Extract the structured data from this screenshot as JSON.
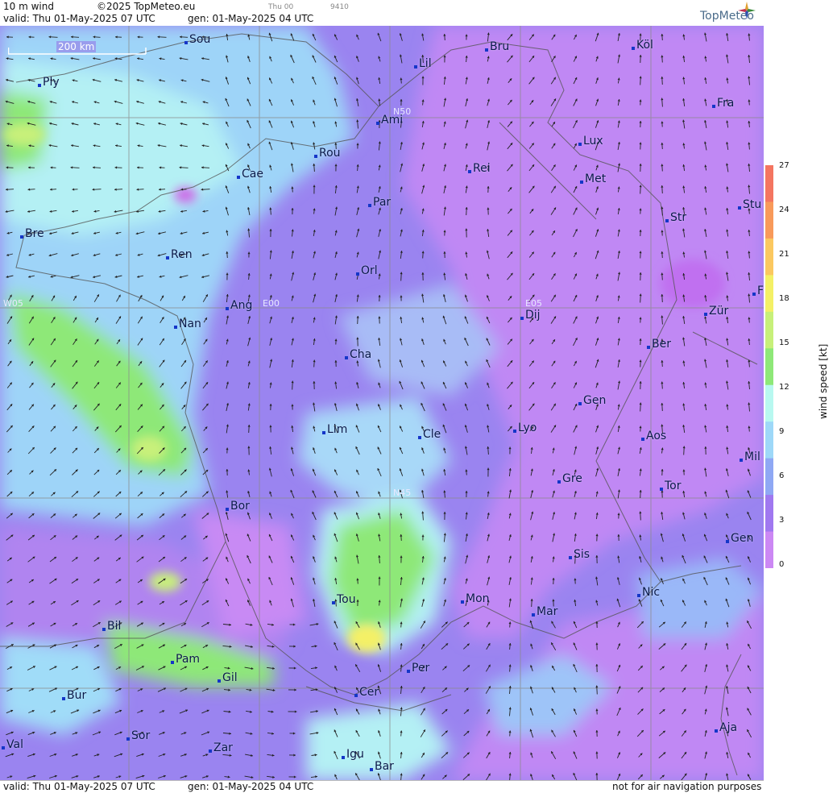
{
  "header": {
    "product": "10 m wind",
    "copyright": "©2025 TopMeteo.eu",
    "valid": "valid:  Thu  01-May-2025  07 UTC",
    "gen": "gen: 01-May-2025 04 UTC",
    "small_day": "Thu 00",
    "small_code": "9410",
    "logo": "TopMeteo"
  },
  "scale_bar": {
    "label": "200 km"
  },
  "footer": {
    "valid": "valid:  Thu  01-May-2025  07 UTC",
    "gen": "gen: 01-May-2025 04 UTC",
    "disclaimer": "not for air navigation purposes"
  },
  "colorbar": {
    "title": "wind speed [kt]",
    "ticks": [
      "27",
      "24",
      "21",
      "18",
      "15",
      "12",
      "9",
      "6",
      "3",
      "0"
    ],
    "colors": [
      "#f47560",
      "#f89a5a",
      "#fbc860",
      "#f4f066",
      "#c7f07a",
      "#8ee878",
      "#b8f8f0",
      "#9ed8f8",
      "#8fa8f4",
      "#a078f0",
      "#cc88f4"
    ]
  },
  "grid_labels": [
    {
      "id": "n50",
      "text": "N50"
    },
    {
      "id": "n45",
      "text": "N45"
    },
    {
      "id": "w05",
      "text": "W05"
    },
    {
      "id": "e00",
      "text": "E00"
    },
    {
      "id": "e05",
      "text": "E05"
    }
  ],
  "cities": [
    {
      "id": "sou",
      "name": "Sou"
    },
    {
      "id": "ply",
      "name": "Ply"
    },
    {
      "id": "lil",
      "name": "Lil"
    },
    {
      "id": "bru",
      "name": "Bru"
    },
    {
      "id": "kol",
      "name": "Köl"
    },
    {
      "id": "fra",
      "name": "Fra"
    },
    {
      "id": "ami",
      "name": "Ami"
    },
    {
      "id": "rou",
      "name": "Rou"
    },
    {
      "id": "lux",
      "name": "Lux"
    },
    {
      "id": "cae",
      "name": "Cae"
    },
    {
      "id": "rei",
      "name": "Rei"
    },
    {
      "id": "met",
      "name": "Met"
    },
    {
      "id": "par",
      "name": "Par"
    },
    {
      "id": "str",
      "name": "Str"
    },
    {
      "id": "stu",
      "name": "Stu"
    },
    {
      "id": "bre",
      "name": "Bre"
    },
    {
      "id": "ren",
      "name": "Ren"
    },
    {
      "id": "orl",
      "name": "Orl"
    },
    {
      "id": "ang",
      "name": "Ang"
    },
    {
      "id": "dij",
      "name": "Dij"
    },
    {
      "id": "zur",
      "name": "Zür"
    },
    {
      "id": "nan",
      "name": "Nan"
    },
    {
      "id": "ber",
      "name": "Ber"
    },
    {
      "id": "cha",
      "name": "Cha"
    },
    {
      "id": "gen1",
      "name": "Gen"
    },
    {
      "id": "lim",
      "name": "Lim"
    },
    {
      "id": "cle",
      "name": "Cle"
    },
    {
      "id": "lyo",
      "name": "Lyo"
    },
    {
      "id": "aos",
      "name": "Aos"
    },
    {
      "id": "mil",
      "name": "Mil"
    },
    {
      "id": "gre",
      "name": "Gre"
    },
    {
      "id": "tor",
      "name": "Tor"
    },
    {
      "id": "bor",
      "name": "Bor"
    },
    {
      "id": "gen2",
      "name": "Gen"
    },
    {
      "id": "sis",
      "name": "Sis"
    },
    {
      "id": "nic",
      "name": "Nic"
    },
    {
      "id": "tou",
      "name": "Tou"
    },
    {
      "id": "mon",
      "name": "Mon"
    },
    {
      "id": "mar",
      "name": "Mar"
    },
    {
      "id": "bil",
      "name": "Bil"
    },
    {
      "id": "pam",
      "name": "Pam"
    },
    {
      "id": "per",
      "name": "Per"
    },
    {
      "id": "gil",
      "name": "Gil"
    },
    {
      "id": "cer",
      "name": "Cer"
    },
    {
      "id": "bur",
      "name": "Bur"
    },
    {
      "id": "aja",
      "name": "Aja"
    },
    {
      "id": "sor",
      "name": "Sor"
    },
    {
      "id": "val",
      "name": "Val"
    },
    {
      "id": "zar",
      "name": "Zar"
    },
    {
      "id": "igu",
      "name": "Igu"
    },
    {
      "id": "bar",
      "name": "Bar"
    },
    {
      "id": "edge",
      "name": "F"
    }
  ]
}
